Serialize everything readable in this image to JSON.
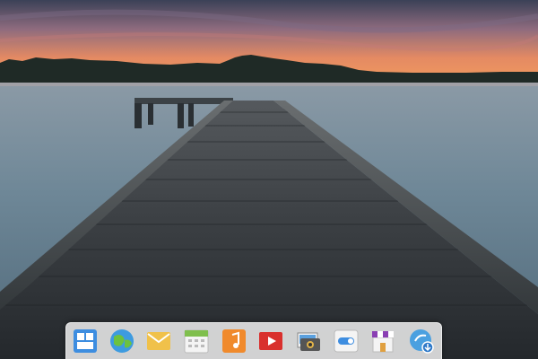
{
  "desktop": {
    "wallpaper": "pier-at-sunset",
    "colors": {
      "sky_top": "#3a3f55",
      "sky_glow": "#f08a5c",
      "water": "#6f8798",
      "pier_wood": "#2d3236"
    }
  },
  "dock": {
    "items": [
      {
        "app": "Multitasking View",
        "icon": "multitasking-view-icon"
      },
      {
        "app": "Web Browser",
        "icon": "web-browser-icon"
      },
      {
        "app": "Mail",
        "icon": "mail-icon"
      },
      {
        "app": "Calendar",
        "icon": "calendar-icon"
      },
      {
        "app": "Music",
        "icon": "music-icon"
      },
      {
        "app": "Videos",
        "icon": "videos-icon"
      },
      {
        "app": "Photos",
        "icon": "photos-icon"
      },
      {
        "app": "System Settings",
        "icon": "settings-toggle-icon"
      },
      {
        "app": "AppCenter",
        "icon": "appcenter-store-icon"
      },
      {
        "app": "Updates",
        "icon": "software-update-icon"
      }
    ]
  }
}
